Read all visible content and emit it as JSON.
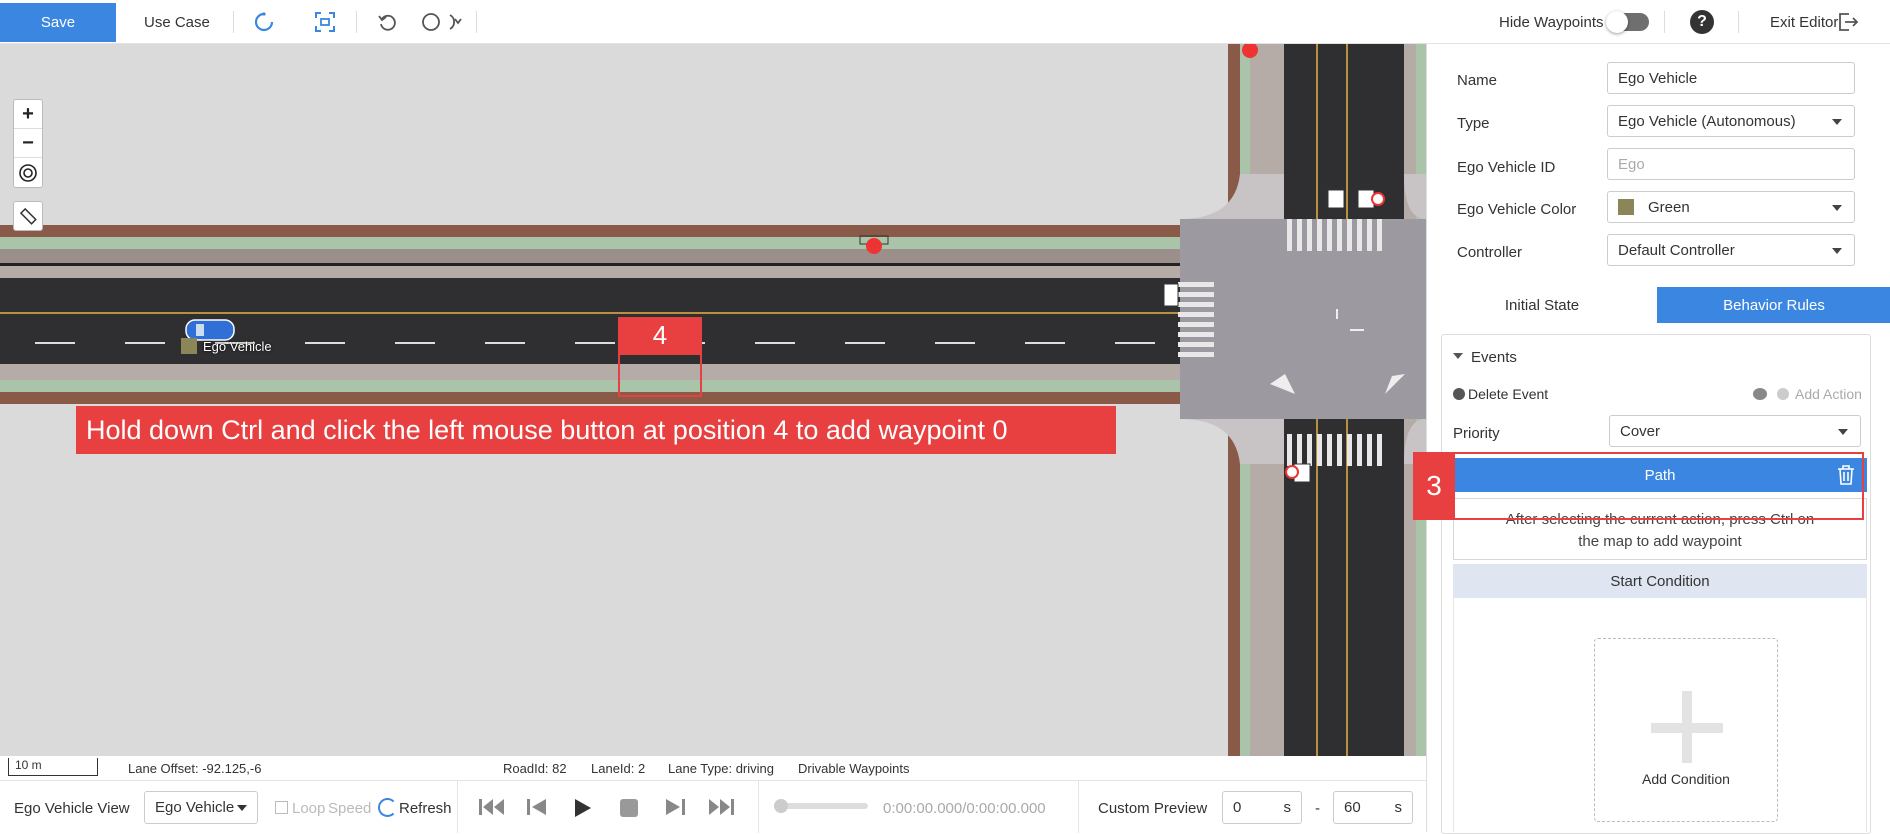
{
  "toolbar": {
    "save_label": "Save",
    "use_case_label": "Use Case",
    "hide_waypoints_label": "Hide Waypoints",
    "help_label": "?",
    "exit_label": "Exit Editor"
  },
  "map": {
    "zoom_in": "+",
    "zoom_out": "−",
    "ego_label": "Ego Vehicle",
    "marker_4": "4",
    "hint_text": "Hold down Ctrl and click the left mouse button at position 4 to add waypoint 0"
  },
  "status": {
    "scale": "10 m",
    "lane_offset": "Lane Offset: -92.125,-6",
    "road_id": "RoadId: 82",
    "lane_id": "LaneId: 2",
    "lane_type": "Lane Type: driving",
    "drivable": "Drivable Waypoints"
  },
  "playbar": {
    "view_label": "Ego Vehicle View",
    "view_select": "Ego Vehicle",
    "loop_label": "Loop",
    "speed_label": "Speed",
    "refresh_label": "Refresh",
    "time": "0:00:00.000/0:00:00.000",
    "custom_preview": "Custom Preview",
    "from_value": "0",
    "from_unit": "s",
    "dash": "-",
    "to_value": "60",
    "to_unit": "s"
  },
  "panel": {
    "name_label": "Name",
    "name_value": "Ego Vehicle",
    "type_label": "Type",
    "type_value": "Ego Vehicle (Autonomous)",
    "id_label": "Ego Vehicle ID",
    "id_placeholder": "Ego",
    "color_label": "Ego Vehicle Color",
    "color_value": "Green",
    "controller_label": "Controller",
    "controller_value": "Default Controller",
    "tab_initial": "Initial State",
    "tab_behavior": "Behavior Rules",
    "events_label": "Events",
    "delete_event": "Delete Event",
    "add_action": "Add Action",
    "priority_label": "Priority",
    "priority_value": "Cover",
    "path_label": "Path",
    "path_note": "After selecting the current action, press Ctrl on the map to add waypoint",
    "marker_3": "3",
    "start_condition": "Start Condition",
    "add_condition": "Add Condition"
  },
  "colors": {
    "accent": "#3b86e0",
    "marker": "#e84040",
    "ego_color": "#8c8558"
  }
}
